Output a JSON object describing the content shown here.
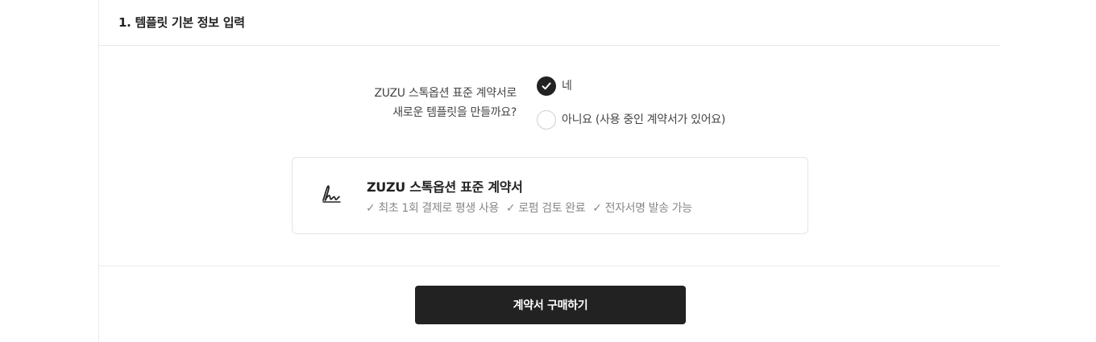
{
  "section": {
    "title": "1. 템플릿 기본 정보 입력"
  },
  "question": {
    "line1": "ZUZU 스톡옵션 표준 계약서로",
    "line2": "새로운 템플릿을 만들까요?"
  },
  "options": [
    {
      "label": "네",
      "selected": true
    },
    {
      "label": "아니요 (사용 중인 계약서가 있어요)",
      "selected": false
    }
  ],
  "card": {
    "icon": "signature-icon",
    "title": "ZUZU 스톡옵션 표준 계약서",
    "features": [
      "✓ 최초 1회 결제로 평생 사용",
      "✓ 로펌 검토 완료",
      "✓ 전자서명 발송 가능"
    ]
  },
  "cta": {
    "label": "계약서 구매하기"
  },
  "colors": {
    "primary": "#222222",
    "border": "#e4e4e4",
    "muted_text": "#888888"
  }
}
